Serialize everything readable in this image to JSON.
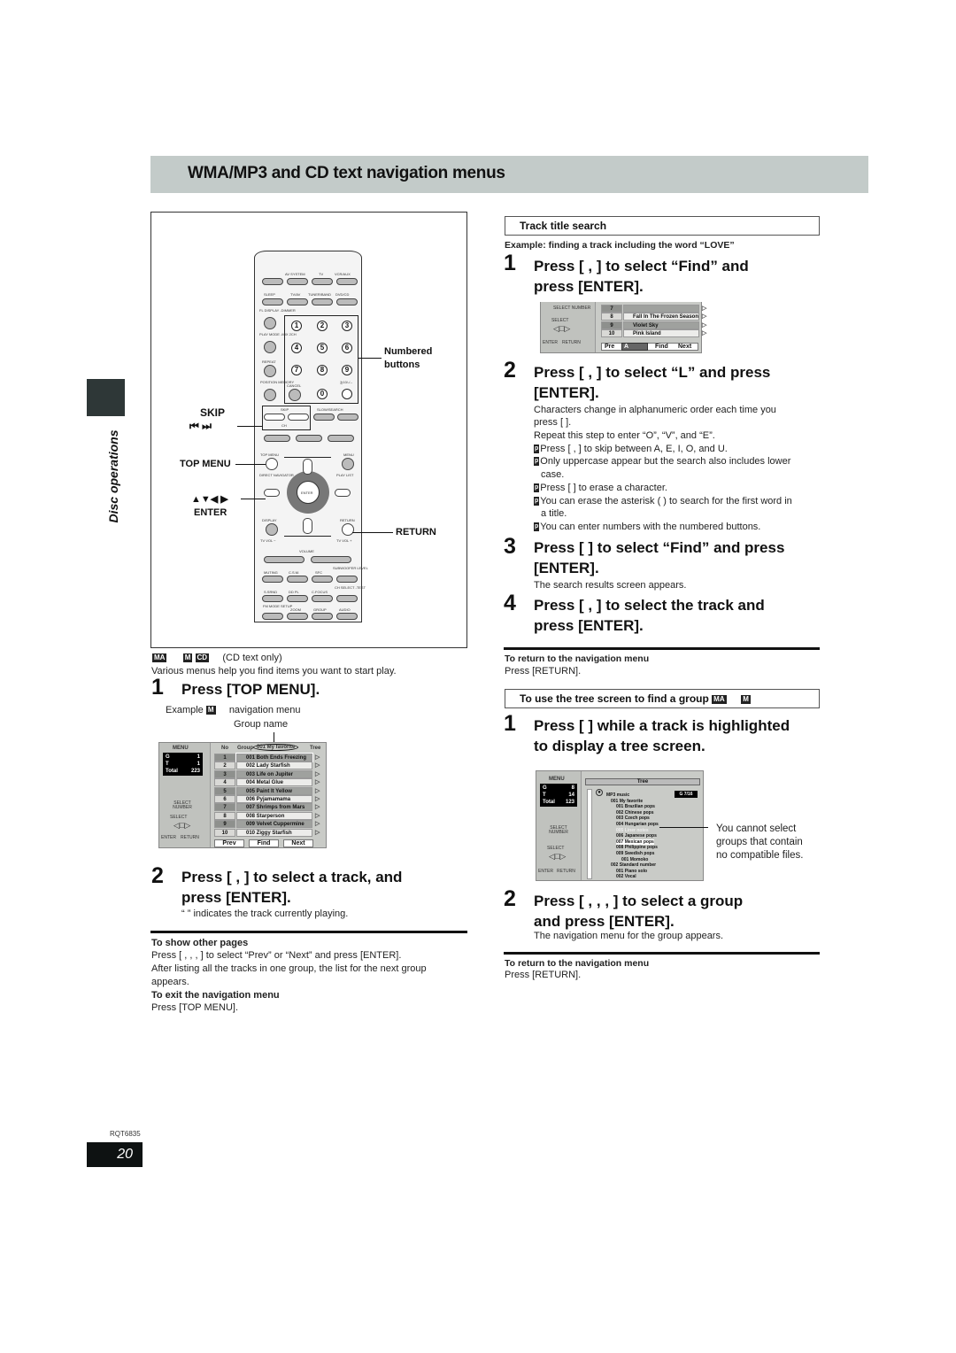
{
  "page": {
    "title": "WMA/MP3 and CD text navigation menus",
    "side_label": "Disc operations",
    "doc_code": "RQT6835",
    "page_number": "20"
  },
  "remote": {
    "top_labels": [
      "AV SYSTEM",
      "TV",
      "VCR/AUX"
    ],
    "row2_labels": [
      "SLEEP",
      "TV/AV",
      "TUNER/BAND",
      "DVD/CD"
    ],
    "left_labels": [
      "FL DISPLAY -DIMMER",
      "PLAY MODE -MIX 2CH",
      "REPEAT",
      "POSITION MEMORY"
    ],
    "cancel": "CANCEL",
    "ten_plus": "≧10/-/--",
    "numbers": [
      "1",
      "2",
      "3",
      "4",
      "5",
      "6",
      "7",
      "8",
      "9",
      "0"
    ],
    "skip": "SKIP",
    "slow_search": "SLOW/SEARCH",
    "ch": "CH",
    "top_menu_small": "TOP MENU",
    "menu_small": "MENU",
    "direct_nav": "DIRECT NAVIGATOR",
    "play_list": "PLAY LIST",
    "enter_small": "ENTER",
    "display": "DISPLAY",
    "return_small": "RETURN",
    "tv_vol_minus": "TV VOL −",
    "tv_vol_plus": "TV VOL +",
    "volume": "VOLUME",
    "bottom_labels": [
      "MUTING",
      "C.S.M.",
      "SFC",
      "SUBWOOFER LEVEL",
      "S.SRND",
      "DD PL",
      "C.FOCUS",
      "CH SELECT -TEST",
      "FM MODE SETUP",
      "ZOOM",
      "GROUP",
      "AUDIO"
    ],
    "callouts": {
      "numbered_buttons": "Numbered buttons",
      "skip": "SKIP",
      "skip_icons": "⏮ ⏭",
      "top_menu": "TOP MENU",
      "arrows": "▲▼◀ ▶",
      "enter": "ENTER",
      "return": "RETURN"
    }
  },
  "left_col": {
    "badges": [
      "MA",
      "M",
      "CD"
    ],
    "badge_note": "(CD text only)",
    "intro": "Various menus help you find items you want to start play.",
    "step1": {
      "num": "1",
      "heading": "Press [TOP MENU]."
    },
    "example_label": "Example",
    "example_badge": "M",
    "example_text": "navigation menu",
    "group_name_label": "Group name",
    "nav_screen": {
      "menu": "MENU",
      "g_label": "G",
      "g_val": "1",
      "t_label": "T",
      "t_val": "1",
      "total_label": "Total",
      "total_val": "223",
      "select_number": "SELECT NUMBER",
      "select": "SELECT",
      "enter": "ENTER",
      "return": "RETURN",
      "col_no": "No",
      "col_group": "Group",
      "group_value": "001 My favorite",
      "col_tree": "Tree",
      "tracks": [
        {
          "no": "1",
          "name": "001 Both Ends Freezing"
        },
        {
          "no": "2",
          "name": "002 Lady Starfish"
        },
        {
          "no": "3",
          "name": "003 Life on Jupiter"
        },
        {
          "no": "4",
          "name": "004 Metal Glue"
        },
        {
          "no": "5",
          "name": "005 Paint It Yellow"
        },
        {
          "no": "6",
          "name": "006 Pyjamamama"
        },
        {
          "no": "7",
          "name": "007 Shrimps from Mars"
        },
        {
          "no": "8",
          "name": "008 Starperson"
        },
        {
          "no": "9",
          "name": "009 Velvet Cuppermine"
        },
        {
          "no": "10",
          "name": "010 Ziggy Starfish"
        }
      ],
      "buttons": [
        "Prev",
        "Find",
        "Next"
      ]
    },
    "step2": {
      "num": "2",
      "heading_l1": "Press [    ,     ] to select a track, and",
      "heading_l2": "press [ENTER].",
      "note": "“     ” indicates the track currently playing."
    },
    "other_pages_title": "To show other pages",
    "other_pages_l1": "Press [    ,     ,     ,     ] to select “Prev” or “Next” and press [ENTER].",
    "other_pages_l2": "After listing all the tracks in one group, the list for the next group",
    "other_pages_l3": "appears.",
    "exit_title": "To exit the navigation menu",
    "exit_text": "Press [TOP MENU]."
  },
  "right_col": {
    "track_search_title": "Track title search",
    "example": "Example:  finding a track including the word “LOVE”",
    "step1": {
      "num": "1",
      "l1": "Press [    ,     ] to select “Find” and",
      "l2": "press [ENTER]."
    },
    "find_screen": {
      "select_number": "SELECT NUMBER",
      "select": "SELECT",
      "enter": "ENTER",
      "return": "RETURN",
      "rows": [
        {
          "no": "7",
          "name": ""
        },
        {
          "no": "8",
          "name": "Fall In The Frozen Season"
        },
        {
          "no": "9",
          "name": "Violet Sky"
        },
        {
          "no": "10",
          "name": "Pink Island"
        }
      ],
      "prev": "Pre",
      "input": "A",
      "find": "Find",
      "next": "Next"
    },
    "step2": {
      "num": "2",
      "l1": "Press [    ,     ] to select “L” and press",
      "l2": "[ENTER].",
      "p1": "Characters change in alphanumeric order each time you",
      "p2": "press [    ].",
      "p3": "Repeat this step to enter “O”, “V”, and “E”.",
      "bullets": [
        "Press [         ,         ] to skip between A, E, I, O, and U.",
        "Only uppercase appear but the search also includes lower",
        "case.",
        "Press [    ] to erase a character.",
        "You can erase the asterisk (    ) to search for the first word in",
        "a title.",
        "You can enter numbers with the numbered buttons."
      ],
      "bullet_mark": "p"
    },
    "step3": {
      "num": "3",
      "l1": "Press [    ] to select “Find” and press",
      "l2": "[ENTER].",
      "note": "The search results screen appears."
    },
    "step4": {
      "num": "4",
      "l1": "Press [    ,     ] to select the track and",
      "l2": "press [ENTER]."
    },
    "return1_title": "To return to the navigation menu",
    "return1_text": "Press [RETURN].",
    "tree_title": "To use the tree screen to find a group",
    "tree_badges": [
      "MA",
      "M"
    ],
    "tstep1": {
      "num": "1",
      "l1": "Press [    ] while a track is highlighted",
      "l2": "to display a tree screen."
    },
    "tree_screen": {
      "menu": "MENU",
      "g_label": "G",
      "g_val": "8",
      "t_label": "T",
      "t_val": "14",
      "total_label": "Total",
      "total_val": "123",
      "select_number": "SELECT NUMBER",
      "select": "SELECT",
      "enter": "ENTER",
      "return": "RETURN",
      "tree_header": "Tree",
      "group_badge": "G  7/16",
      "items": [
        "MP3 music",
        "001 My favorite",
        "001 Brazilian pops",
        "002 Chinese pops",
        "003 Czech pops",
        "004 Hungarian pops",
        "005 Liner notes",
        "006 Japanese pops",
        "007 Mexican pops",
        "008 Philippine pops",
        "009 Swedish pops",
        "001 Momoko",
        "002 Standard number",
        "001 Piano solo",
        "002 Vocal"
      ]
    },
    "tree_note": [
      "You cannot select",
      "groups that contain",
      "no compatible files."
    ],
    "tstep2": {
      "num": "2",
      "l1": "Press [    ,     ,     ,     ] to select a group",
      "l2": "and press [ENTER].",
      "note": "The navigation menu for the group appears."
    },
    "return2_title": "To return to the navigation menu",
    "return2_text": "Press [RETURN]."
  }
}
